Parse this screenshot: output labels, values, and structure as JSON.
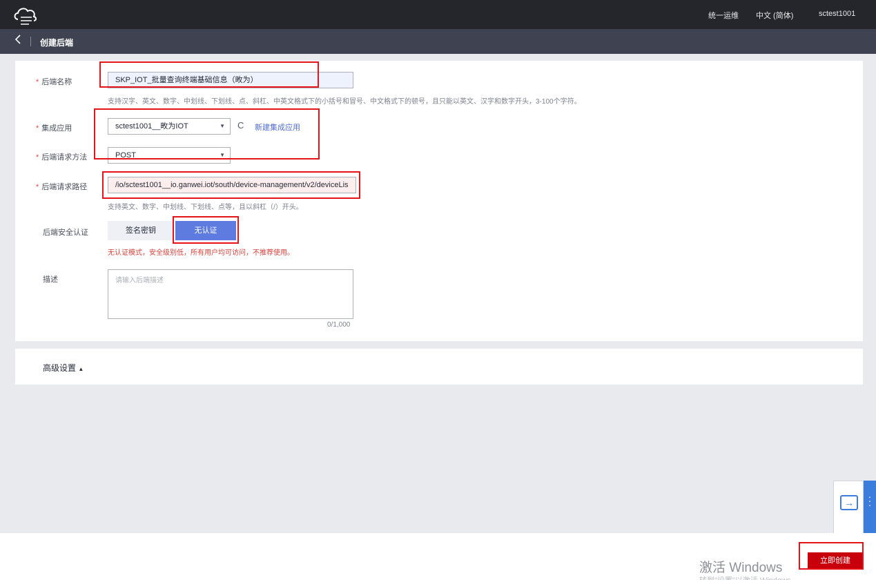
{
  "header": {
    "logo_icon": "cloud-icon",
    "links": [
      "统一运维",
      "中文 (简体)",
      "sctest1001"
    ]
  },
  "subheader": {
    "back_icon": "chevron-left-icon",
    "title": "创建后端"
  },
  "form": {
    "backend_name": {
      "label": "后端名称",
      "required_mark": "*",
      "value": "SKP_IOT_批量查询终端基础信息（畋为）",
      "hint": "支持汉字、英文、数字、中划线、下划线、点、斜杠、中英文格式下的小括号和冒号、中文格式下的顿号，且只能以英文、汉字和数字开头，3-100个字符。"
    },
    "integration_app": {
      "label": "集成应用",
      "required_mark": "*",
      "value": "sctest1001__畋为IOT",
      "refresh_icon": "refresh-icon",
      "create_link": "新建集成应用"
    },
    "request_method": {
      "label": "后端请求方法",
      "required_mark": "*",
      "value": "POST"
    },
    "request_path": {
      "label": "后端请求路径",
      "required_mark": "*",
      "value": "/io/sctest1001__io.ganwei.iot/south/device-management/v2/deviceLis",
      "hint": "支持英文、数字、中划线、下划线、点等，且以斜杠（/）开头。"
    },
    "security_auth": {
      "label": "后端安全认证",
      "options": [
        "签名密钥",
        "无认证"
      ],
      "selected": "无认证",
      "warning": "无认证模式，安全级别低，所有用户均可访问，不推荐使用。"
    },
    "description": {
      "label": "描述",
      "placeholder": "请输入后端描述",
      "counter": "0/1,000"
    }
  },
  "advanced": {
    "label": "高级设置",
    "toggle_icon": "caret-up-icon"
  },
  "side_tool": {
    "icon": "export-icon"
  },
  "footer": {
    "watermark": "激活 Windows",
    "watermark_sub": "转到\"设置\"以激活 Windows。",
    "create_button": "立即创建"
  },
  "colors": {
    "topbar": "#25262b",
    "subbar": "#3f4351",
    "primary": "#5e7ce0",
    "danger_button": "#c7000b",
    "annotation_box": "#e5121a"
  }
}
